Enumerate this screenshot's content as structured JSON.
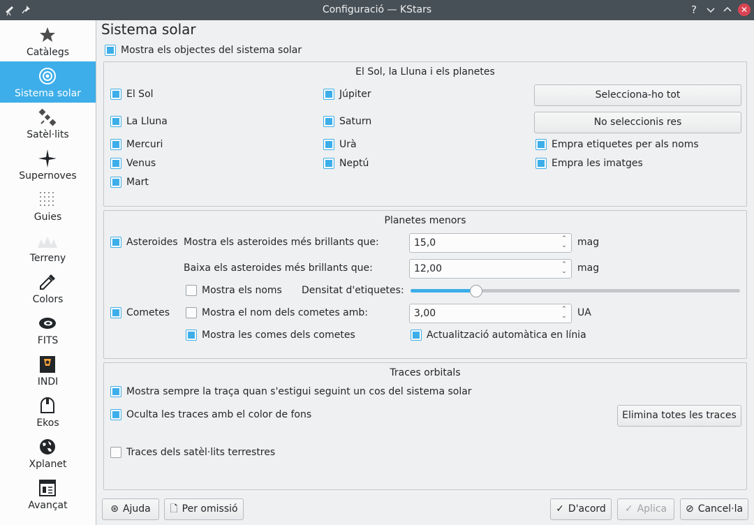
{
  "window": {
    "title": "Configuració — KStars"
  },
  "titlebar_buttons": [
    "help-icon",
    "minimize-icon",
    "maximize-icon",
    "close-icon"
  ],
  "sidebar": {
    "items": [
      {
        "label": "Catàlegs",
        "icon": "star-icon",
        "active": false
      },
      {
        "label": "Sistema solar",
        "icon": "solar-system-icon",
        "active": true
      },
      {
        "label": "Satèl·lits",
        "icon": "satellite-icon",
        "active": false
      },
      {
        "label": "Supernoves",
        "icon": "supernova-icon",
        "active": false
      },
      {
        "label": "Guies",
        "icon": "guides-icon",
        "active": false
      },
      {
        "label": "Terreny",
        "icon": "terrain-icon",
        "active": false
      },
      {
        "label": "Colors",
        "icon": "color-picker-icon",
        "active": false
      },
      {
        "label": "FITS",
        "icon": "fits-icon",
        "active": false
      },
      {
        "label": "INDI",
        "icon": "indi-icon",
        "active": false
      },
      {
        "label": "Ekos",
        "icon": "ekos-icon",
        "active": false
      },
      {
        "label": "Xplanet",
        "icon": "globe-icon",
        "active": false
      },
      {
        "label": "Avançat",
        "icon": "advanced-icon",
        "active": false
      }
    ]
  },
  "page": {
    "title": "Sistema solar",
    "show_solar_system": {
      "label": "Mostra els objectes del sistema solar",
      "checked": true
    }
  },
  "planets_group": {
    "title": "El Sol, la Lluna i els planetes",
    "col1": [
      {
        "label": "El Sol",
        "checked": true
      },
      {
        "label": "La Lluna",
        "checked": true
      },
      {
        "label": "Mercuri",
        "checked": true
      },
      {
        "label": "Venus",
        "checked": true
      },
      {
        "label": "Mart",
        "checked": true
      }
    ],
    "col2": [
      {
        "label": "Júpiter",
        "checked": true
      },
      {
        "label": "Saturn",
        "checked": true
      },
      {
        "label": "Urà",
        "checked": true
      },
      {
        "label": "Neptú",
        "checked": true
      }
    ],
    "select_all": "Selecciona-ho tot",
    "select_none": "No seleccionis res",
    "use_name_labels": {
      "label": "Empra etiquetes per als noms",
      "checked": true
    },
    "use_images": {
      "label": "Empra les imatges",
      "checked": true
    }
  },
  "minor_group": {
    "title": "Planetes menors",
    "asteroids": {
      "label": "Asteroides",
      "checked": true
    },
    "show_brighter_label": "Mostra els asteroides més brillants que:",
    "show_brighter_value": "15,0",
    "hide_brighter_label": "Baixa els asteroides més brillants que:",
    "hide_brighter_value": "12,00",
    "mag_unit": "mag",
    "show_names": {
      "label": "Mostra els noms",
      "checked": false
    },
    "label_density_label": "Densitat d'etiquetes:",
    "label_density": 0.2,
    "comets": {
      "label": "Cometes",
      "checked": true
    },
    "comet_names": {
      "label": "Mostra el nom dels cometes amb:",
      "checked": false
    },
    "comet_names_value": "3,00",
    "au_unit": "UA",
    "comet_comas": {
      "label": "Mostra les comes dels cometes",
      "checked": true
    },
    "auto_update": {
      "label": "Actualització automàtica en línia",
      "checked": true
    }
  },
  "trails_group": {
    "title": "Traces orbitals",
    "always_trail": {
      "label": "Mostra sempre la traça quan s'estigui seguint un cos del sistema solar",
      "checked": true
    },
    "fade_trails": {
      "label": "Oculta les traces amb el color de fons",
      "checked": true
    },
    "clear_all": "Elimina totes les traces",
    "satellite_trails": {
      "label": "Traces dels satèl·lits terrestres",
      "checked": false
    }
  },
  "footer": {
    "help": "Ajuda",
    "defaults": "Per omissió",
    "ok": "D'acord",
    "apply": "Aplica",
    "cancel": "Cancel·la"
  },
  "colors": {
    "accent": "#3daee9",
    "titlebar": "#475057",
    "close": "#da4453"
  }
}
